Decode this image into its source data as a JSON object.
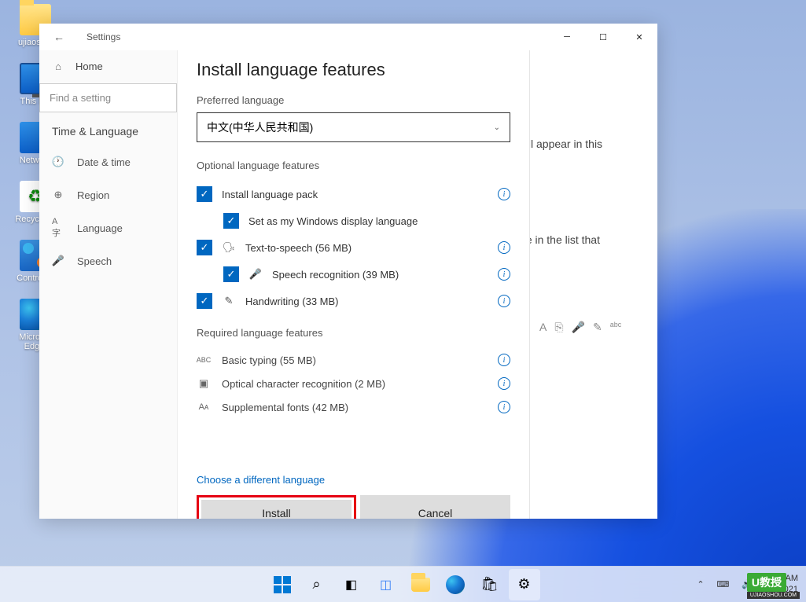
{
  "desktop": {
    "icons": [
      {
        "label": "ujiaosh..."
      },
      {
        "label": "This P..."
      },
      {
        "label": "Netwo..."
      },
      {
        "label": "Recycle ..."
      },
      {
        "label": "Control ..."
      },
      {
        "label": "Micros... Edg..."
      }
    ]
  },
  "window": {
    "title": "Settings",
    "back_icon": "←"
  },
  "sidebar": {
    "home": "Home",
    "search_placeholder": "Find a setting",
    "category": "Time & Language",
    "items": [
      {
        "icon": "clock",
        "label": "Date & time"
      },
      {
        "icon": "globe",
        "label": "Region"
      },
      {
        "icon": "lang",
        "label": "Language"
      },
      {
        "icon": "mic",
        "label": "Speech"
      }
    ]
  },
  "bg": {
    "line1": "...rer will appear in this",
    "line2": "...guage in the list that"
  },
  "dialog": {
    "title": "Install language features",
    "preferred_lbl": "Preferred language",
    "selected_lang": "中文(中华人民共和国)",
    "optional_lbl": "Optional language features",
    "features": {
      "install_pack": "Install language pack",
      "set_display": "Set as my Windows display language",
      "tts": "Text-to-speech (56 MB)",
      "speech_rec": "Speech recognition (39 MB)",
      "handwriting": "Handwriting (33 MB)"
    },
    "required_lbl": "Required language features",
    "required": {
      "basic": "Basic typing (55 MB)",
      "ocr": "Optical character recognition (2 MB)",
      "fonts": "Supplemental fonts (42 MB)"
    },
    "choose_diff": "Choose a different language",
    "install_btn": "Install",
    "cancel_btn": "Cancel"
  },
  "taskbar": {
    "time": "... AM",
    "date": "6/... 2021"
  },
  "watermark": {
    "main": "U教授",
    "sub": "UJIAOSHOU.COM"
  }
}
